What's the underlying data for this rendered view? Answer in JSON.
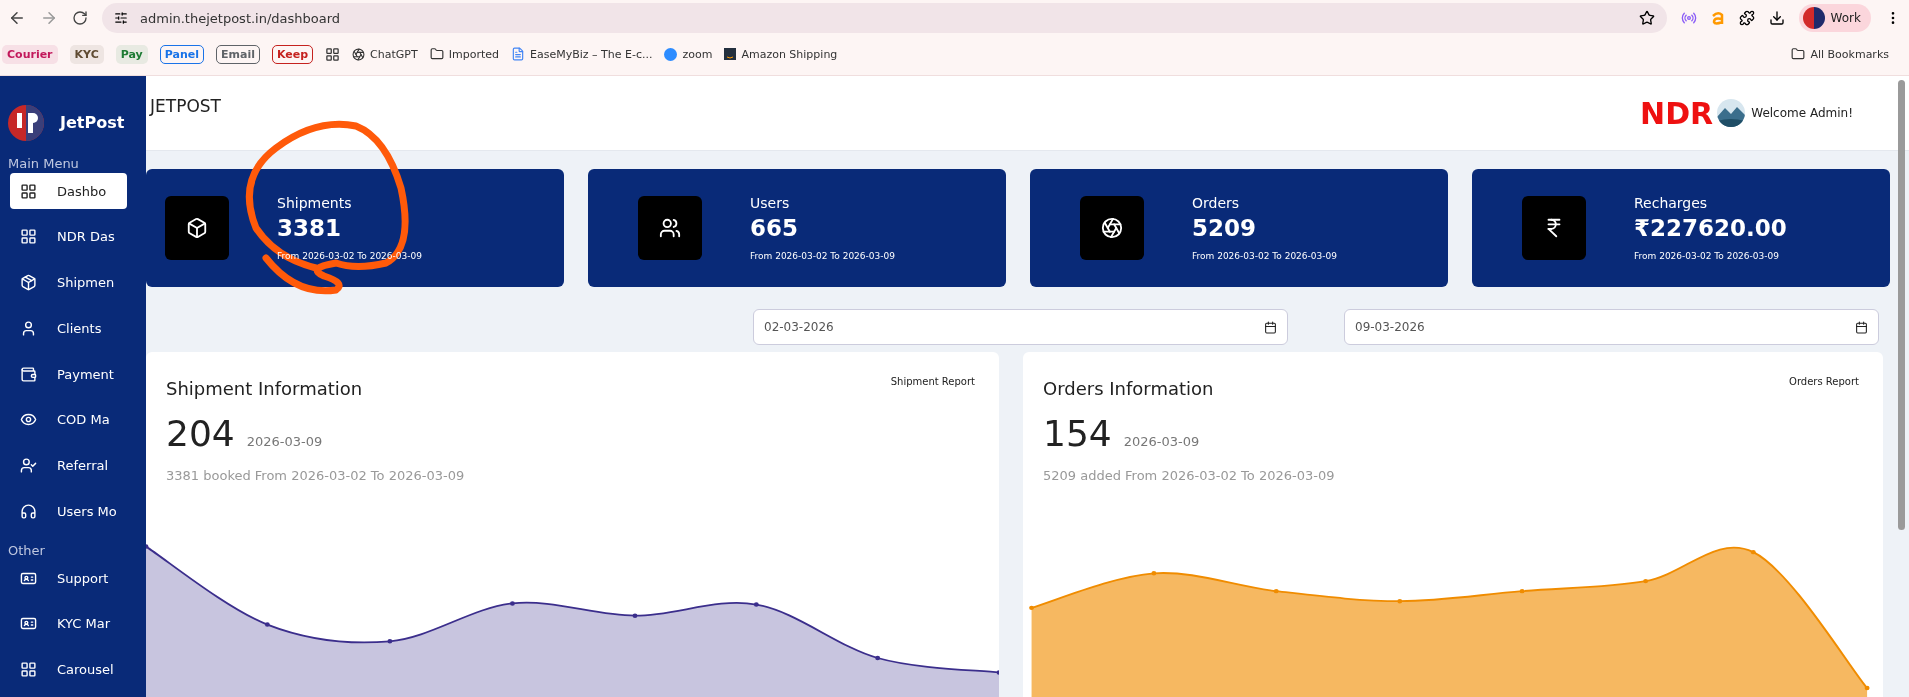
{
  "browser": {
    "url": "admin.thejetpost.in/dashboard",
    "profile": "Work",
    "bookmarks": [
      {
        "label": "Courier",
        "kind": "chip",
        "color": "#c2185b"
      },
      {
        "label": "KYC",
        "kind": "chip",
        "color": "#5f4b32"
      },
      {
        "label": "Pay",
        "kind": "chip",
        "color": "#1e7b34"
      },
      {
        "label": "Panel",
        "kind": "chip",
        "color": "#1a73e8"
      },
      {
        "label": "Email",
        "kind": "chip",
        "color": "#5f6368"
      },
      {
        "label": "Keep",
        "kind": "chip",
        "color": "#c5221f"
      },
      {
        "kind": "apps"
      },
      {
        "label": "ChatGPT",
        "kind": "link"
      },
      {
        "label": "Imported",
        "kind": "folder"
      },
      {
        "label": "EaseMyBiz – The E-c...",
        "kind": "doc"
      },
      {
        "label": "zoom",
        "kind": "zoom"
      },
      {
        "label": "Amazon Shipping",
        "kind": "amazon"
      }
    ],
    "all_bookmarks": "All Bookmarks"
  },
  "sidebar": {
    "brand": "JetPost",
    "sections": [
      {
        "title": "Main Menu",
        "items": [
          {
            "label": "Dashbo",
            "selected": true
          },
          {
            "label": "NDR Das",
            "selected": false
          },
          {
            "label": "Shipmen",
            "selected": false
          },
          {
            "label": "Clients",
            "selected": false
          },
          {
            "label": "Payment",
            "selected": false
          },
          {
            "label": "COD Ma",
            "selected": false
          },
          {
            "label": "Referral",
            "selected": false
          },
          {
            "label": "Users Mo",
            "selected": false
          }
        ]
      },
      {
        "title": "Other",
        "items": [
          {
            "label": "Support",
            "selected": false
          },
          {
            "label": "KYC Mar",
            "selected": false
          },
          {
            "label": "Carousel",
            "selected": false
          }
        ]
      }
    ]
  },
  "header": {
    "title": "JETPOST",
    "ndr": "NDR",
    "welcome": "Welcome Admin!"
  },
  "stats": [
    {
      "title": "Shipments",
      "value": "3381",
      "range": "From 2026-03-02 To 2026-03-09"
    },
    {
      "title": "Users",
      "value": "665",
      "range": "From 2026-03-02 To 2026-03-09"
    },
    {
      "title": "Orders",
      "value": "5209",
      "range": "From 2026-03-02 To 2026-03-09"
    },
    {
      "title": "Recharges",
      "value": "₹227620.00",
      "range": "From 2026-03-02 To 2026-03-09"
    }
  ],
  "date_filters": [
    {
      "value": "02-03-2026"
    },
    {
      "value": "09-03-2026"
    }
  ],
  "info_cards": [
    {
      "title": "Shipment Information",
      "report": "Shipment Report",
      "count": "204",
      "date": "2026-03-09",
      "summary": "3381 booked From 2026-03-02 To 2026-03-09",
      "color": "#3b2e8c"
    },
    {
      "title": "Orders Information",
      "report": "Orders Report",
      "count": "154",
      "date": "2026-03-09",
      "summary": "5209 added From 2026-03-02 To 2026-03-09",
      "color": "#f08c00"
    }
  ]
}
